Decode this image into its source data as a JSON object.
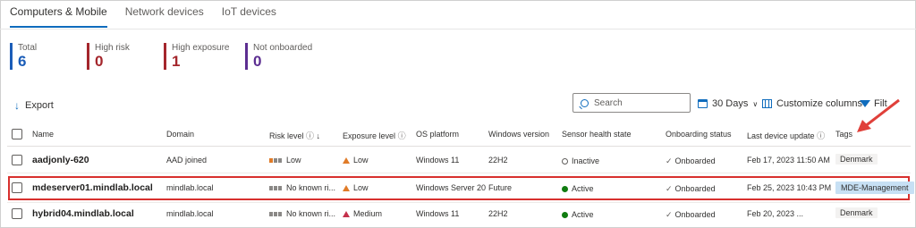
{
  "tabs": [
    "Computers & Mobile",
    "Network devices",
    "IoT devices"
  ],
  "stats": [
    {
      "label": "Total",
      "value": "6",
      "color": "#1b5db8"
    },
    {
      "label": "High risk",
      "value": "0",
      "color": "#a4262c"
    },
    {
      "label": "High exposure",
      "value": "1",
      "color": "#a4262c"
    },
    {
      "label": "Not onboarded",
      "value": "0",
      "color": "#5c2e91"
    }
  ],
  "toolbar": {
    "export": "Export",
    "search_placeholder": "Search",
    "days": "30 Days",
    "customize": "Customize columns",
    "filter": "Filt"
  },
  "columns": {
    "name": "Name",
    "domain": "Domain",
    "risk": "Risk level",
    "exposure": "Exposure level",
    "os": "OS platform",
    "winver": "Windows version",
    "sensor": "Sensor health state",
    "onboarding": "Onboarding status",
    "lastupdate": "Last device update",
    "tags": "Tags"
  },
  "rows": [
    {
      "name": "aadjonly-620",
      "domain": "AAD joined",
      "risk": "Low",
      "exposure": "Low",
      "os": "Windows 11",
      "winver": "22H2",
      "sensor": "Inactive",
      "onboarding": "Onboarded",
      "updated": "Feb 17, 2023 11:50 AM",
      "tag": "Denmark"
    },
    {
      "name": "mdeserver01.mindlab.local",
      "domain": "mindlab.local",
      "risk": "No known ri...",
      "exposure": "Low",
      "os": "Windows Server 20...",
      "winver": "Future",
      "sensor": "Active",
      "onboarding": "Onboarded",
      "updated": "Feb 25, 2023 10:43 PM",
      "tag": "MDE-Management"
    },
    {
      "name": "hybrid04.mindlab.local",
      "domain": "mindlab.local",
      "risk": "No known ri...",
      "exposure": "Medium",
      "os": "Windows 11",
      "winver": "22H2",
      "sensor": "Active",
      "onboarding": "Onboarded",
      "updated": "Feb 20, 2023 ...",
      "tag": "Denmark"
    }
  ],
  "colors": {
    "accent": "#0f6cbd",
    "highlight": "#d8302e"
  }
}
